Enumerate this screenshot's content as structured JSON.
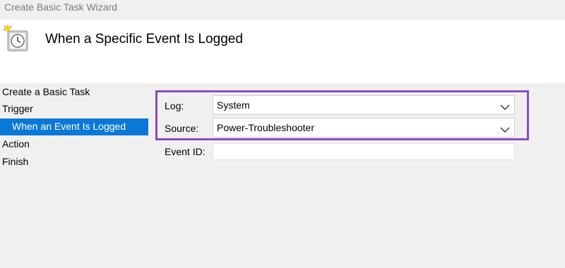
{
  "window": {
    "title": "Create Basic Task Wizard"
  },
  "header": {
    "heading": "When a Specific Event Is Logged",
    "icon": "task-scheduler-clock-icon"
  },
  "steps": [
    {
      "label": "Create a Basic Task",
      "active": false
    },
    {
      "label": "Trigger",
      "active": false
    },
    {
      "label": "When an Event Is Logged",
      "active": true
    },
    {
      "label": "Action",
      "active": false
    },
    {
      "label": "Finish",
      "active": false
    }
  ],
  "form": {
    "log": {
      "label": "Log:",
      "value": "System"
    },
    "source": {
      "label": "Source:",
      "value": "Power-Troubleshooter"
    },
    "event_id": {
      "label": "Event ID:",
      "value": ""
    }
  },
  "colors": {
    "active_step": "#0a78d7",
    "highlight_border": "#8a4cc0"
  }
}
